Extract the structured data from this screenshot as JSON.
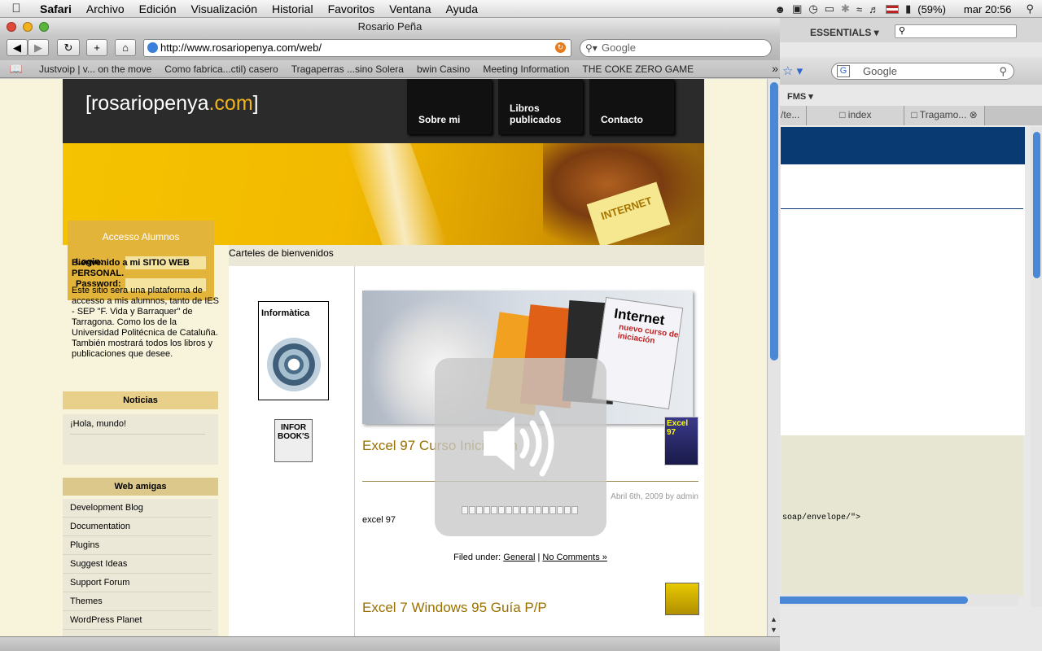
{
  "menubar": {
    "app": "Safari",
    "items": [
      "Archivo",
      "Edición",
      "Visualización",
      "Historial",
      "Favoritos",
      "Ventana",
      "Ayuda"
    ],
    "battery": "(59%)",
    "clock": "mar 20:56"
  },
  "window": {
    "title": "Rosario Peña",
    "url": "http://www.rosariopenya.com/web/",
    "search_placeholder": "Google"
  },
  "bookmarks": [
    "Justvoip | v... on the move",
    "Como fabrica...ctil) casero",
    "Tragaperras ...sino Solera",
    "bwin Casino",
    "Meeting Information",
    "THE COKE ZERO GAME"
  ],
  "bg_window": {
    "essentials": "ESSENTIALS ▾",
    "search_placeholder": "Google",
    "fms": "FMS ▾",
    "tabs": [
      "/te...",
      "index",
      "Tragamo..."
    ],
    "code_text": "soap/envelope/\">"
  },
  "site": {
    "logo_open": "[rosariopenya",
    "logo_com": ".com",
    "logo_close": "]",
    "nav": [
      {
        "label": "Sobre mi"
      },
      {
        "label": "Libros publicados"
      },
      {
        "label": "Contacto"
      }
    ],
    "login": {
      "title": "Accesso Alumnos",
      "login_label": "Login:",
      "password_label": "Password:"
    },
    "welcome_title": "Bienvenido a mi SITIO WEB PERSONAL.",
    "welcome_text": "Este sitio sera una plataforma de accesso a mis alumnos, tanto de IES - SEP \"F. Vida y Barraquer\" de Tarragona. Como los de la Universidad Politécnica de Cataluña. También mostrará todos los libros y publicaciones que desee.",
    "news_title": "Noticias",
    "news_items": [
      "¡Hola, mundo!"
    ],
    "friends_title": "Web amigas",
    "friends": [
      "Development Blog",
      "Documentation",
      "Plugins",
      "Suggest Ideas",
      "Support Forum",
      "Themes",
      "WordPress Planet"
    ],
    "carteles": "Carteles de bienvenidos",
    "bookA_title": "Informàtica",
    "bookB_title": "INFOR BOOK'S",
    "banner_book": "Internet",
    "banner_sub": "nuevo curso de iniciación",
    "post1": {
      "title": "Excel 97 Curso Iniciación",
      "thumb": "Excel 97",
      "date": "Abril 6th, 2009 by admin",
      "text": "excel 97",
      "filed_label": "Filed under:",
      "category": "General",
      "sep": "|",
      "comments": "No Comments »"
    },
    "post2_title": "Excel 7 Windows 95 Guía P/P"
  },
  "volume": {
    "level": 0,
    "segments": 16
  }
}
